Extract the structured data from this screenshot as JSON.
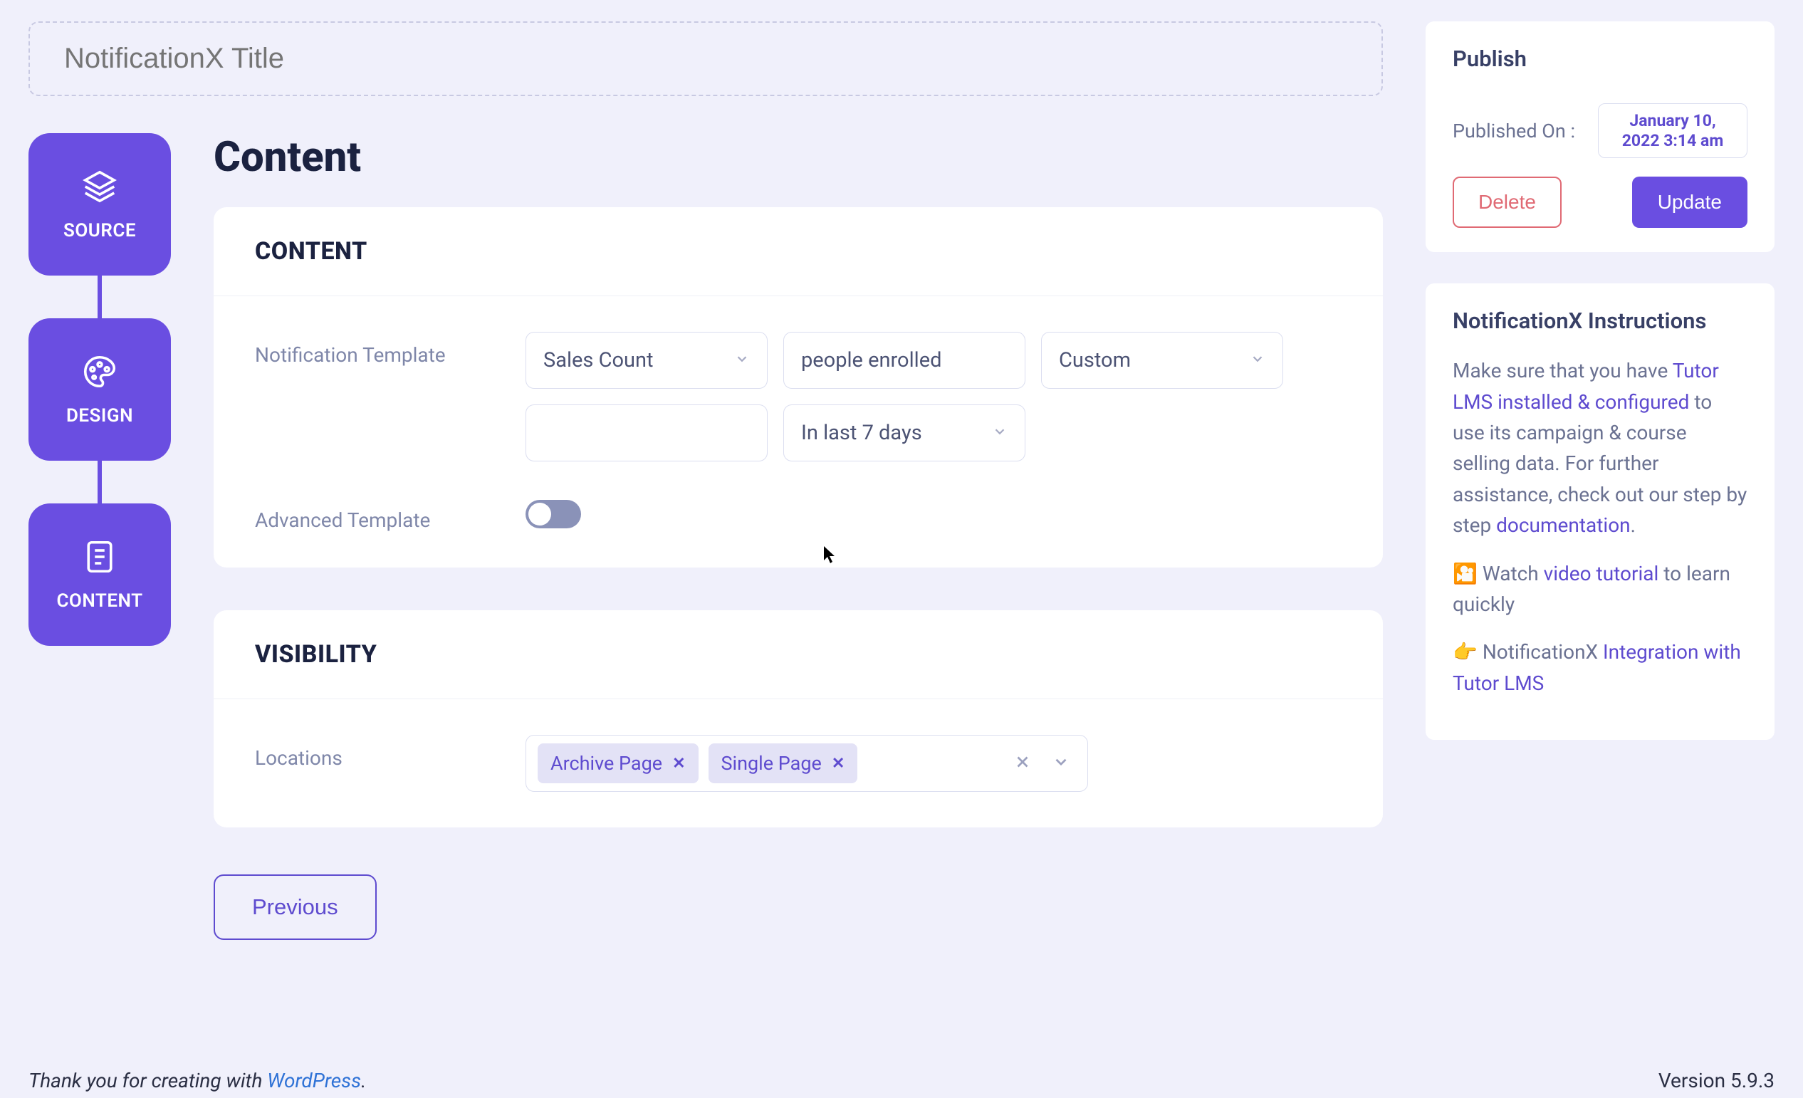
{
  "title_placeholder": "NotificationX Title",
  "steps": [
    "SOURCE",
    "DESIGN",
    "CONTENT"
  ],
  "page_title": "Content",
  "content_card": {
    "header": "CONTENT",
    "template_label": "Notification Template",
    "template_select_1": "Sales Count",
    "template_text_2": "people enrolled",
    "template_select_3": "Custom",
    "template_text_4": "",
    "template_select_5": "In last 7 days",
    "advanced_label": "Advanced Template",
    "advanced_on": false
  },
  "visibility_card": {
    "header": "VISIBILITY",
    "locations_label": "Locations",
    "locations": [
      "Archive Page",
      "Single Page"
    ]
  },
  "previous_label": "Previous",
  "publish": {
    "title": "Publish",
    "published_on_label": "Published On :",
    "date": "January 10, 2022 3:14 am",
    "delete": "Delete",
    "update": "Update"
  },
  "instructions": {
    "title": "NotificationX Instructions",
    "p1_pre": "Make sure that you have ",
    "p1_link1": "Tutor LMS installed & configured",
    "p1_mid": " to use its campaign & course selling data. For further assistance, check out our step by step ",
    "p1_link2": "documentation",
    "p1_end": ".",
    "p2_icon": "🎦",
    "p2_pre": " Watch ",
    "p2_link": "video tutorial",
    "p2_end": " to learn quickly",
    "p3_icon": "👉",
    "p3_pre": " NotificationX ",
    "p3_link": "Integration with Tutor LMS"
  },
  "footer": {
    "thank_pre": "Thank you for creating with ",
    "thank_link": "WordPress",
    "thank_end": ".",
    "version": "Version 5.9.3"
  }
}
